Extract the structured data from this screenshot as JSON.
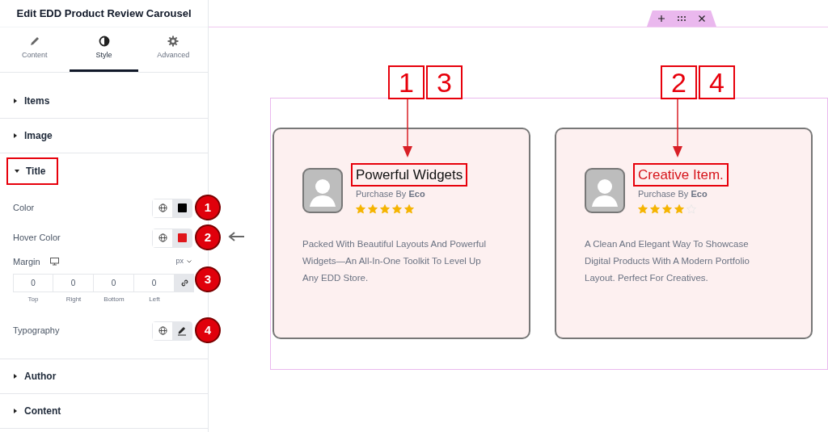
{
  "panel": {
    "title": "Edit EDD Product Review Carousel",
    "tabs": [
      {
        "label": "Content",
        "selected": false
      },
      {
        "label": "Style",
        "selected": true
      },
      {
        "label": "Advanced",
        "selected": false
      }
    ],
    "sections_before": [
      {
        "label": "Items",
        "expanded": false
      },
      {
        "label": "Image",
        "expanded": false
      }
    ],
    "open_section": {
      "label": "Title",
      "expanded": true
    },
    "controls": [
      {
        "kind": "color",
        "label": "Color",
        "color": "#000000",
        "badge": "1"
      },
      {
        "kind": "color",
        "label": "Hover Color",
        "color": "#e0161b",
        "badge": "2"
      },
      {
        "kind": "margin",
        "label": "Margin",
        "unit": "px",
        "fields": [
          {
            "value": "0",
            "label": "Top"
          },
          {
            "value": "0",
            "label": "Right"
          },
          {
            "value": "0",
            "label": "Bottom"
          },
          {
            "value": "0",
            "label": "Left"
          }
        ],
        "badge": "3"
      },
      {
        "kind": "typography",
        "label": "Typography",
        "badge": "4"
      }
    ],
    "sections_after": [
      {
        "label": "Author",
        "expanded": false
      },
      {
        "label": "Content",
        "expanded": false
      }
    ]
  },
  "cards": [
    {
      "markers": [
        "1",
        "3"
      ],
      "title": "Powerful Widgets",
      "color": "#111111",
      "byline": "Purchase By **Eco**",
      "stars": 5,
      "description": "Packed With Beautiful Layouts And Powerful Widgets—An All-In-One Toolkit To Level Up Any EDD Store."
    },
    {
      "markers": [
        "2",
        "4"
      ],
      "title": "Creative Item.",
      "color": "#d6141a",
      "byline": "Purchase By **Eco**",
      "stars": 4,
      "description": "A Clean And Elegant Way To Showcase Digital Products With A Modern Portfolio Layout. Perfect For Creatives."
    }
  ]
}
